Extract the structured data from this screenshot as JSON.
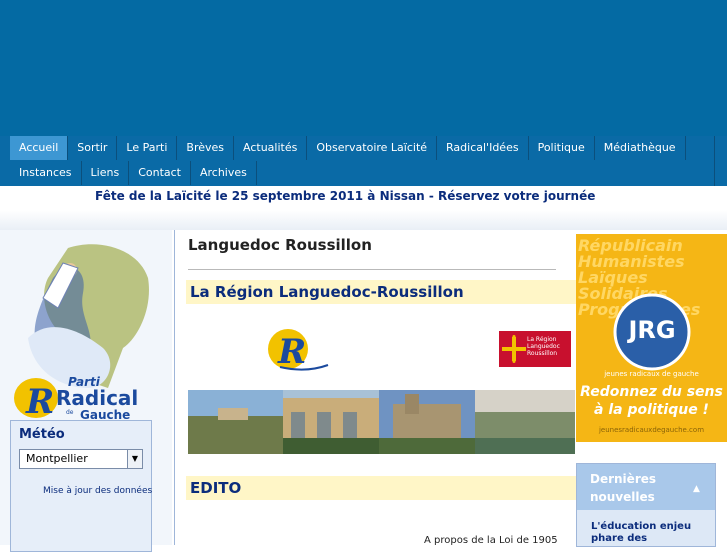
{
  "nav": {
    "row1": [
      "Accueil",
      "Sortir",
      "Le Parti",
      "Brèves",
      "Actualités",
      "Observatoire Laïcité",
      "Radical'Idées",
      "Politique",
      "Médiathèque"
    ],
    "row2": [
      "Instances",
      "Liens",
      "Contact",
      "Archives"
    ],
    "active": "Accueil"
  },
  "banner": {
    "text": "Fête de la Laïcité le 25 septembre 2011 à Nissan - Réservez votre journée"
  },
  "logo": {
    "word1": "Parti",
    "word2": "Radical",
    "word3": "de",
    "word4": "Gauche",
    "letter": "R"
  },
  "meteo": {
    "title": "Météo",
    "city": "Montpellier",
    "update": "Mise à jour des données"
  },
  "main": {
    "page_title": "Languedoc Roussillon",
    "section1": "La Région Languedoc-Roussillon",
    "section2": "EDITO",
    "paragraph_start": "A propos de la Loi de 1905",
    "region_logo_text": "La Région Languedoc Roussillon"
  },
  "ad": {
    "bg_lines": [
      "Républicain",
      "Humanistes",
      "Laïques",
      "Solidaires",
      "Progressistes"
    ],
    "brand": "JRG",
    "sub": "jeunes radicaux de gauche",
    "slogan1": "Redonnez du sens",
    "slogan2": "à la politique !",
    "site": "jeunesradicauxdegauche.com"
  },
  "news": {
    "title": "Dernières nouvelles",
    "item": "L'éducation enjeu phare des"
  },
  "colors": {
    "header": "#046aa3",
    "nav": "#0a6aa6",
    "active_tab": "#3d97d3",
    "section_bg": "#fff6c7",
    "title_blue": "#0b2c7c",
    "ad_orange": "#f5b615"
  }
}
